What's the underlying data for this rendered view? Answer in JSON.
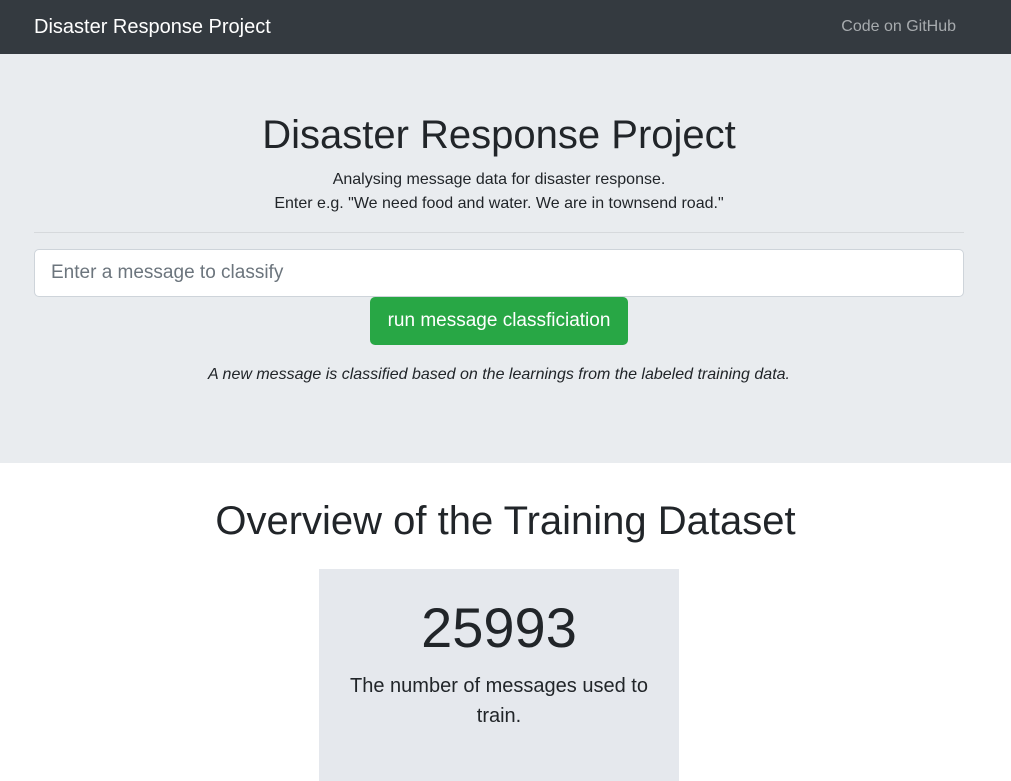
{
  "navbar": {
    "brand": "Disaster Response Project",
    "github_link": "Code on GitHub"
  },
  "hero": {
    "title": "Disaster Response Project",
    "lead_line1": "Analysing message data for disaster response.",
    "lead_line2": "Enter e.g. \"We need food and water. We are in townsend road.\"",
    "input_placeholder": "Enter a message to classify",
    "input_value": "",
    "button_label": "run message classficiation",
    "note": "A new message is classified based on the learnings from the labeled training data."
  },
  "overview": {
    "title": "Overview of the Training Dataset",
    "stat_value": "25993",
    "stat_label": "The number of messages used to train."
  },
  "colors": {
    "navbar_bg": "#343a40",
    "jumbotron_bg": "#e9ecef",
    "button_green": "#28a745",
    "card_bg": "#e5e8ed"
  }
}
